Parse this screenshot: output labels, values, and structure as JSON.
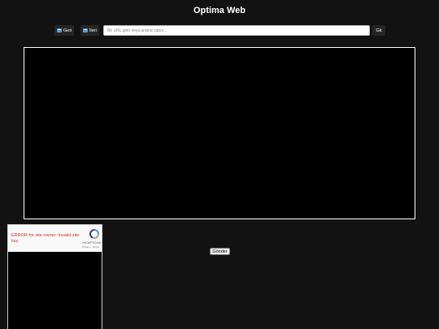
{
  "header": {
    "title": "Optima Web"
  },
  "nav": {
    "back_label": "Geri",
    "forward_label": "İleri",
    "url_placeholder": "Bir URL girin veya arama yapın...",
    "url_value": "",
    "go_label": "Git"
  },
  "captcha": {
    "error_text": "ERROR for site owner: Invalid site key",
    "brand": "reCAPTCHA",
    "privacy_link": "Privacy",
    "terms_link": "Terms"
  },
  "form": {
    "submit_label": "Gönder"
  },
  "colors": {
    "background": "#121212",
    "frame_border": "#ffffff",
    "error": "#d32f2f"
  }
}
